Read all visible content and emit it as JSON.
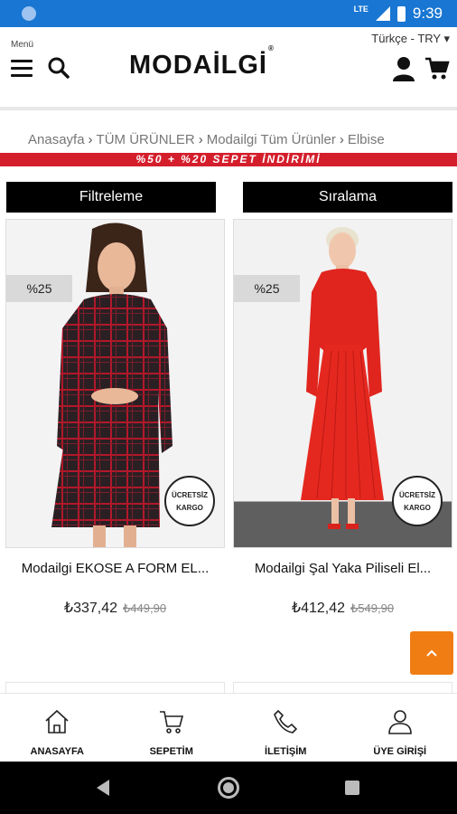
{
  "status": {
    "network": "LTE",
    "time": "9:39"
  },
  "header": {
    "menu_label": "Menü",
    "logo": "MODAİLGİ",
    "logo_mark": "®",
    "language_currency": "Türkçe - TRY ▾"
  },
  "breadcrumb": [
    "Anasayfa",
    "TÜM ÜRÜNLER",
    "Modailgi Tüm Ürünler",
    "Elbise"
  ],
  "promo_banner": "%50 + %20 SEPET İNDİRİMİ",
  "controls": {
    "filter_label": "Filtreleme",
    "sort_label": "Sıralama"
  },
  "products": [
    {
      "discount": "%25",
      "kargo": [
        "ÜCRETSİZ",
        "KARGO"
      ],
      "name": "Modailgi EKOSE A FORM EL...",
      "price": "₺337,42",
      "old_price": "₺449,90"
    },
    {
      "discount": "%25",
      "kargo": [
        "ÜCRETSİZ",
        "KARGO"
      ],
      "name": "Modailgi Şal Yaka Piliseli El...",
      "price": "₺412,42",
      "old_price": "₺549,90"
    }
  ],
  "scroll_top_icon": "chevron-up-icon",
  "bottom_nav": [
    {
      "label": "ANASAYFA",
      "icon": "home-icon"
    },
    {
      "label": "SEPETİM",
      "icon": "cart-icon"
    },
    {
      "label": "İLETİŞİM",
      "icon": "phone-icon"
    },
    {
      "label": "ÜYE GİRİŞİ",
      "icon": "user-icon"
    }
  ],
  "colors": {
    "status_bar": "#1976d2",
    "promo": "#d41e2c",
    "accent_orange": "#f07d13"
  }
}
